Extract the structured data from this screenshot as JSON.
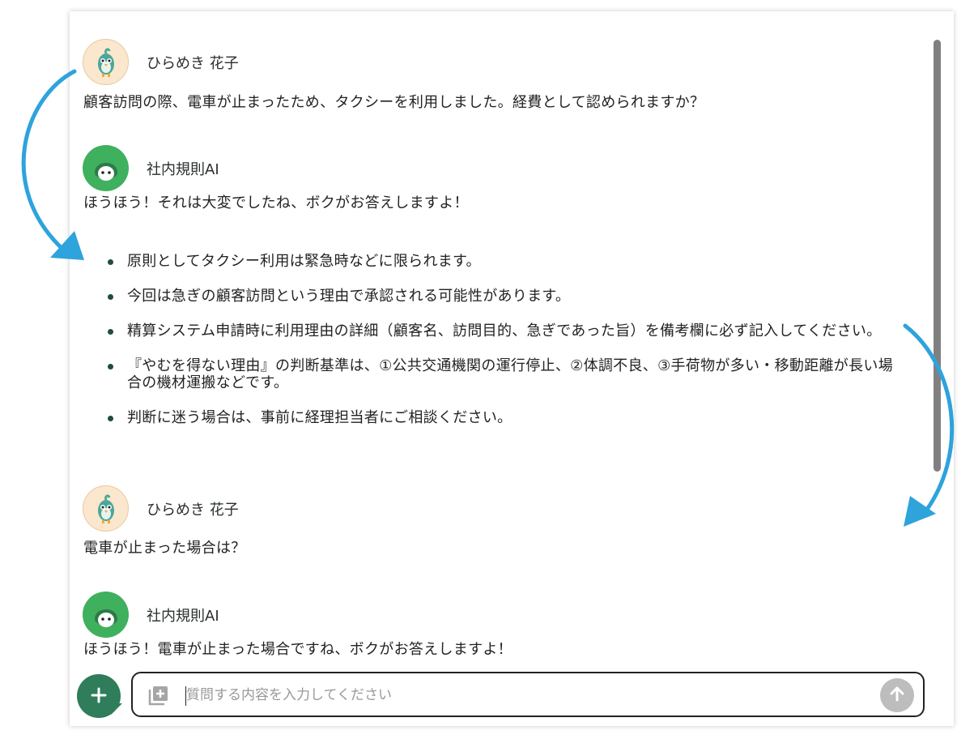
{
  "messages": [
    {
      "sender": "ひらめき 花子",
      "text": "顧客訪問の際、電車が止まったため、タクシーを利用しました。経費として認められますか？"
    },
    {
      "sender": "社内規則AI",
      "text": "ほうほう！それは大変でしたね、ボクがお答えしますよ！",
      "bullets": [
        "原則としてタクシー利用は緊急時などに限られます。",
        "今回は急ぎの顧客訪問という理由で承認される可能性があります。",
        "精算システム申請時に利用理由の詳細（顧客名、訪問目的、急ぎであった旨）を備考欄に必ず記入してください。",
        "『やむを得ない理由』の判断基準は、①公共交通機関の運行停止、②体調不良、③手荷物が多い・移動距離が長い場合の機材運搬などです。",
        "判断に迷う場合は、事前に経理担当者にご相談ください。"
      ]
    },
    {
      "sender": "ひらめき 花子",
      "text": "電車が止まった場合は？"
    },
    {
      "sender": "社内規則AI",
      "text": "ほうほう！電車が止まった場合ですね、ボクがお答えしますよ！"
    }
  ],
  "composer": {
    "placeholder": "質問する内容を入力してください",
    "value": "",
    "add_icon": "plus-icon",
    "attach_icon": "add-attachment-icon",
    "send_icon": "arrow-up-icon"
  },
  "colors": {
    "accent_green": "#2f7d5a",
    "ai_avatar": "#3fb05e",
    "annotation_arrow": "#2ea3dc"
  }
}
